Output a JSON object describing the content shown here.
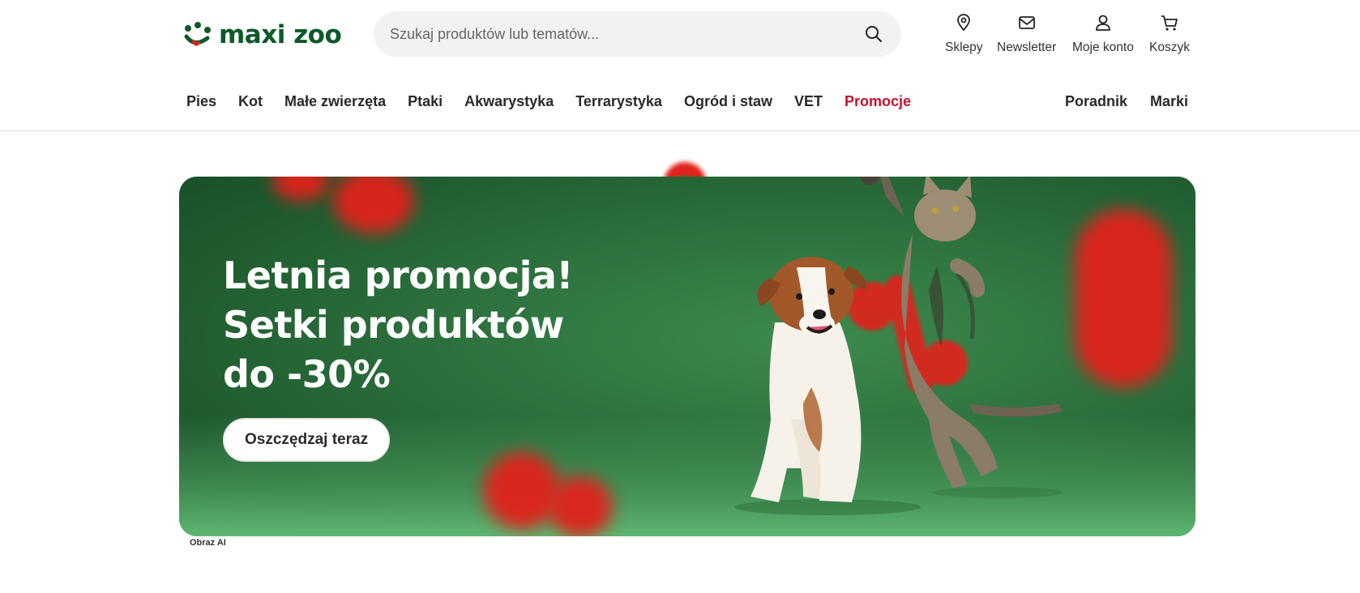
{
  "brand": {
    "name": "maxi zoo",
    "color": "#0c5a2a",
    "accent": "#e2231a"
  },
  "search": {
    "placeholder": "Szukaj produktów lub tematów..."
  },
  "utilities": [
    {
      "label": "Sklepy",
      "icon": "map-pin-icon"
    },
    {
      "label": "Newsletter",
      "icon": "mail-icon"
    },
    {
      "label": "Moje konto",
      "icon": "user-icon"
    },
    {
      "label": "Koszyk",
      "icon": "cart-icon"
    }
  ],
  "nav": {
    "main": [
      "Pies",
      "Kot",
      "Małe zwierzęta",
      "Ptaki",
      "Akwarystyka",
      "Terrarystyka",
      "Ogród i staw",
      "VET",
      "Promocje"
    ],
    "right": [
      "Poradnik",
      "Marki"
    ],
    "promo_color": "#c8102e"
  },
  "hero": {
    "line1": "Letnia promocja!",
    "line2": "Setki produktów",
    "line3": "do -30%",
    "cta": "Oszczędzaj teraz",
    "caption": "Obraz AI",
    "background": "#2f7440"
  }
}
